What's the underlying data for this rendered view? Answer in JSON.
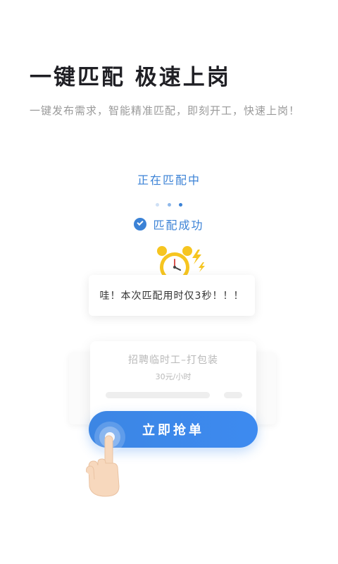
{
  "header": {
    "title": "一键匹配 极速上岗",
    "subtitle": "一键发布需求，智能精准匹配，即刻开工，快速上岗！"
  },
  "status": {
    "matching": "正在匹配中",
    "success": "匹配成功"
  },
  "bubble": {
    "text": "哇！本次匹配用时仅3秒！！！"
  },
  "job_card": {
    "title": "招聘临时工–打包装",
    "salary": "30元/小时"
  },
  "action": {
    "label": "立即抢单"
  },
  "colors": {
    "accent": "#3b82d6",
    "button": "#3d8af0",
    "clock": "#f6c520"
  },
  "icons": [
    "check-circle-icon",
    "alarm-clock-icon",
    "lightning-icon",
    "tap-hand-icon"
  ]
}
